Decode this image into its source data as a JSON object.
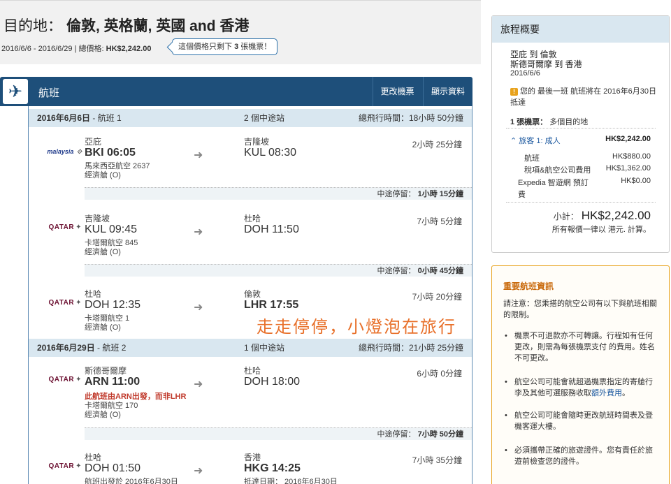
{
  "header": {
    "dest_prefix": "目的地：",
    "dest_value": "倫敦, 英格蘭, 英國 and 香港",
    "dates": "2016/6/6 - 2016/6/29 | 總價格: ",
    "total_price": "HK$2,242.00",
    "seats_before": "這個價格只剩下 ",
    "seats_count": "3",
    "seats_after": " 張機票！"
  },
  "flight_bar": {
    "title": "航班",
    "change_label": "更改機票",
    "details_label": "顯示資料"
  },
  "legs": [
    {
      "date": "2016年6月6日",
      "label": " - 航班 1",
      "stops": "2 個中途站",
      "duration": "總飛行時間：18小時 50分鐘",
      "segments": [
        {
          "airline_logo": "malaysia",
          "dep_city": "亞庇",
          "dep_time": "BKI 06:05",
          "flight": "馬來西亞航空 2637",
          "cabin": "經濟艙 (O)",
          "arr_city": "吉隆坡",
          "arr_time": "KUL 08:30",
          "duration": "2小時 25分鐘"
        },
        {
          "airline_logo": "QATAR",
          "dep_city": "吉隆坡",
          "dep_time": "KUL 09:45",
          "flight": "卡塔爾航空 845",
          "cabin": "經濟艙 (O)",
          "arr_city": "杜哈",
          "arr_time": "DOH 11:50",
          "duration": "7小時 5分鐘"
        },
        {
          "airline_logo": "QATAR",
          "dep_city": "杜哈",
          "dep_time": "DOH 12:35",
          "flight": "卡塔爾航空 1",
          "cabin": "經濟艙 (O)",
          "arr_city": "倫敦",
          "arr_time": "LHR 17:55",
          "duration": "7小時 20分鐘"
        }
      ],
      "layovers": [
        {
          "label": "中途停留： ",
          "value": "1小時 15分鐘"
        },
        {
          "label": "中途停留： ",
          "value": "0小時 45分鐘"
        }
      ]
    },
    {
      "date": "2016年6月29日",
      "label": " - 航班 2",
      "stops": "1 個中途站",
      "duration": "總飛行時間：21小時 25分鐘",
      "segments": [
        {
          "airline_logo": "QATAR",
          "dep_city": "斯德哥爾摩",
          "dep_time": "ARN 11:00",
          "warning": "此航班由ARN出發，而非LHR",
          "flight": "卡塔爾航空 170",
          "cabin": "經濟艙 (O)",
          "arr_city": "杜哈",
          "arr_time": "DOH 18:00",
          "duration": "6小時 0分鐘"
        },
        {
          "airline_logo": "QATAR",
          "dep_city": "杜哈",
          "dep_time": "DOH 01:50",
          "departure_note": "航班出發於 2016年6月30日",
          "arr_city": "香港",
          "arr_time": "HKG 14:25",
          "arrival_note": "抵達日期： 2016年6月30日",
          "duration": "7小時 35分鐘"
        }
      ],
      "layovers": [
        {
          "label": "中途停留： ",
          "value": "7小時 50分鐘"
        }
      ]
    }
  ],
  "watermark": "走走停停，小燈泡在旅行",
  "trip_summary": {
    "title": "旅程概要",
    "route_1": "亞庇 到 倫敦",
    "route_2": "斯德哥爾摩 到 香港",
    "date": "2016/6/6",
    "notice": "您的 最後一班 航班將在 2016年6月30日 抵達",
    "tickets_label": "1 張機票：",
    "tickets_value": " 多個目的地",
    "traveller": "旅客 1: 成人",
    "traveller_price": "HK$2,242.00",
    "lines": [
      {
        "label": "航班",
        "value": "HK$880.00"
      },
      {
        "label": "稅項&航空公司費用",
        "value": "HK$1,362.00"
      },
      {
        "label": "Expedia 智遊網 預訂",
        "label2": "費",
        "value": "HK$0.00"
      }
    ],
    "subtotal_label": "小計：",
    "subtotal_value": "HK$2,242.00",
    "currency_note": "所有報價一律以 港元. 計算。"
  },
  "important": {
    "title": "重要航班資訊",
    "intro": "請注意：您乘搭的航空公司有以下與航班相關的限制。",
    "items": [
      "機票不可退款亦不可轉讓。行程如有任何更改，則需為每張機票支付 的費用。姓名不可更改。",
      "航空公司可能會就超過機票指定的寄艙行李及其他可選服務收取",
      "航空公司可能會隨時更改航班時間表及登機客運大樓。",
      "必須攜帶正確的旅遊證件。您有責任於旅遊前檢查您的證件。"
    ],
    "extra_fee_link": "額外費用",
    "extra_fee_end": "。"
  },
  "icons": {
    "plane": "✈",
    "arrow": "➜",
    "chevron_up": "⌃",
    "warning": "!",
    "qatar_mark": "✦"
  },
  "colors": {
    "bar_blue": "#1e4f7a",
    "header_row": "#d9e7f0",
    "warning_red": "#c0392b",
    "important_border": "#e8a21c",
    "watermark_orange": "#e8702a"
  }
}
